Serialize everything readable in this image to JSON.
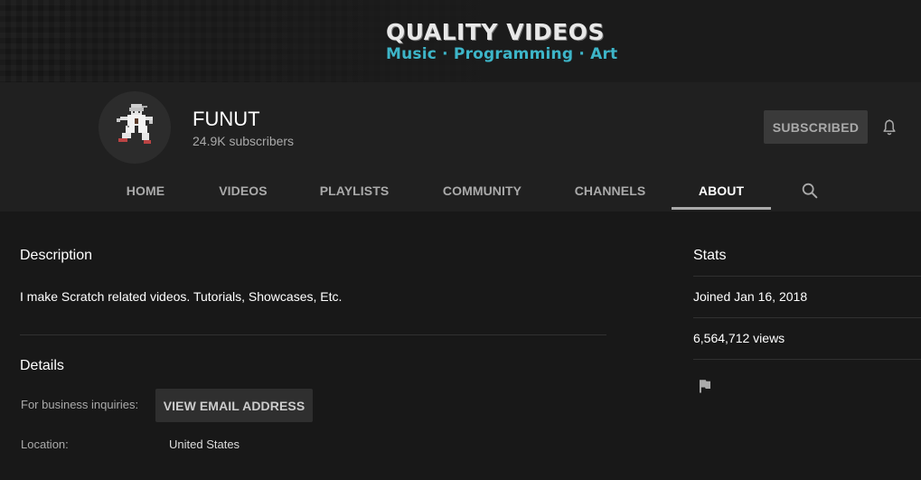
{
  "banner": {
    "title": "QUALITY VIDEOS",
    "subtitle": "Music · Programming · Art"
  },
  "channel": {
    "name": "FUNUT",
    "subscribers": "24.9K subscribers",
    "subscribe_label": "SUBSCRIBED",
    "avatar_icon": "pixel-ninja-avatar",
    "bell_icon": "bell-icon"
  },
  "tabs": [
    {
      "label": "HOME",
      "active": false
    },
    {
      "label": "VIDEOS",
      "active": false
    },
    {
      "label": "PLAYLISTS",
      "active": false
    },
    {
      "label": "COMMUNITY",
      "active": false
    },
    {
      "label": "CHANNELS",
      "active": false
    },
    {
      "label": "ABOUT",
      "active": true
    }
  ],
  "about": {
    "description_heading": "Description",
    "description_text": "I make Scratch related videos. Tutorials, Showcases, Etc.",
    "details_heading": "Details",
    "business_label": "For business inquiries:",
    "email_button_label": "VIEW EMAIL ADDRESS",
    "location_label": "Location:",
    "location_value": "United States"
  },
  "stats": {
    "heading": "Stats",
    "joined": "Joined Jan 16, 2018",
    "views": "6,564,712 views",
    "flag_icon": "flag-icon"
  },
  "colors": {
    "banner_accent": "#3db5c8",
    "header_bg": "#202020",
    "page_bg": "#181818"
  }
}
